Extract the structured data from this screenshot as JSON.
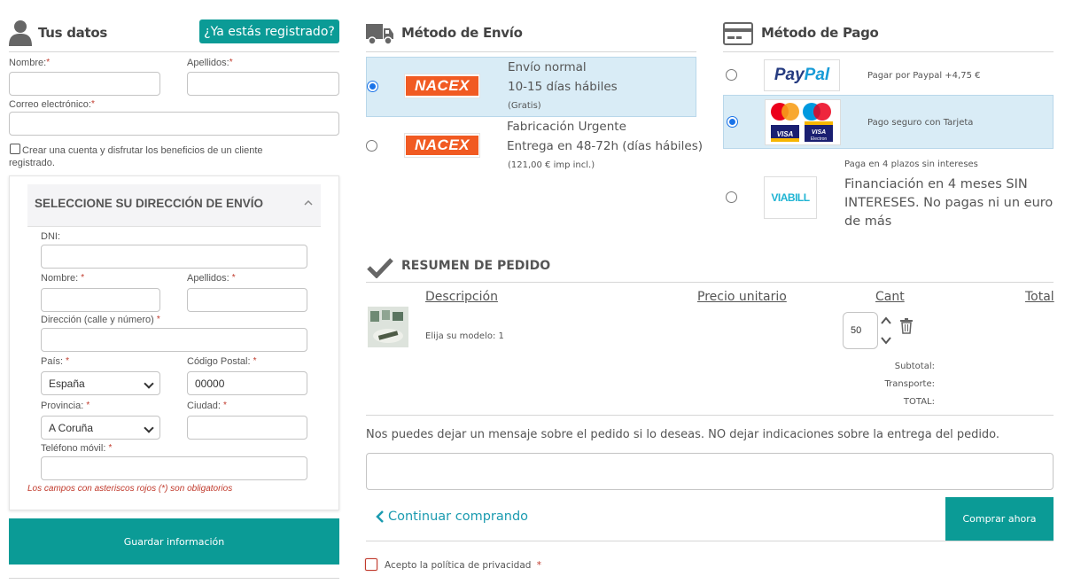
{
  "customer": {
    "title": "Tus datos",
    "registered_button": "¿Ya estás registrado?",
    "first_name_label": "Nombre:",
    "last_name_label": "Apellidos:",
    "email_label": "Correo electrónico:",
    "create_account_label": "Crear una cuenta y disfrutar los beneficios de un cliente registrado.",
    "required_mark": "*"
  },
  "address": {
    "title": "SELECCIONE SU DIRECCIÓN DE ENVÍO",
    "dni_label": "DNI:",
    "first_name_label": "Nombre:",
    "last_name_label": "Apellidos:",
    "street_label": "Dirección (calle y número)",
    "country_label": "País:",
    "country_value": "España",
    "postal_label": "Código Postal:",
    "postal_value": "00000",
    "province_label": "Provincia:",
    "province_value": "A Coruña",
    "city_label": "Ciudad:",
    "phone_label": "Teléfono móvil:",
    "required_note": "Los campos con asteriscos rojos (*) son obligatorios",
    "save_button": "Guardar información"
  },
  "shipping": {
    "title": "Método de Envío",
    "options": [
      {
        "carrier": "NACEX",
        "name": "Envío normal",
        "time": "10-15 días hábiles",
        "price": "(Gratis)",
        "selected": true
      },
      {
        "carrier": "NACEX",
        "name": "Fabricación Urgente",
        "time": "Entrega en 48-72h (días hábiles)",
        "price": "(121,00 € imp incl.)",
        "selected": false
      }
    ]
  },
  "payment": {
    "title": "Método de Pago",
    "options": [
      {
        "brand": "PayPal",
        "label": "Pagar por Paypal +4,75 €",
        "selected": false
      },
      {
        "brand": "Mastercard / Maestro / VISA / VISA Electron",
        "label": "Pago seguro con Tarjeta",
        "selected": true
      },
      {
        "brand": "VIABILL",
        "note": "Paga en 4 plazos sin intereses",
        "label": "Financiación en 4 meses SIN INTERESES. No pagas ni un euro de más",
        "selected": false
      }
    ]
  },
  "order": {
    "title": "RESUMEN DE PEDIDO",
    "headers": {
      "description": "Descripción",
      "unit_price": "Precio unitario",
      "qty": "Cant",
      "total": "Total"
    },
    "item": {
      "variant": "Elija su modelo: 1",
      "qty": "50"
    },
    "subtotal_label": "Subtotal:",
    "shipping_label": "Transporte:",
    "total_label": "TOTAL:",
    "message_prompt": "Nos puedes dejar un mensaje sobre el pedido si lo deseas. NO dejar indicaciones sobre la entrega del pedido.",
    "continue_link": "Continuar comprando",
    "buy_button": "Comprar ahora",
    "privacy_label": "Acepto la política de privacidad",
    "required_mark": "*"
  },
  "colors": {
    "accent": "#0b9b96",
    "selected_bg": "#d9ecf6",
    "required": "#c0392b",
    "nacex": "#f15a22"
  }
}
